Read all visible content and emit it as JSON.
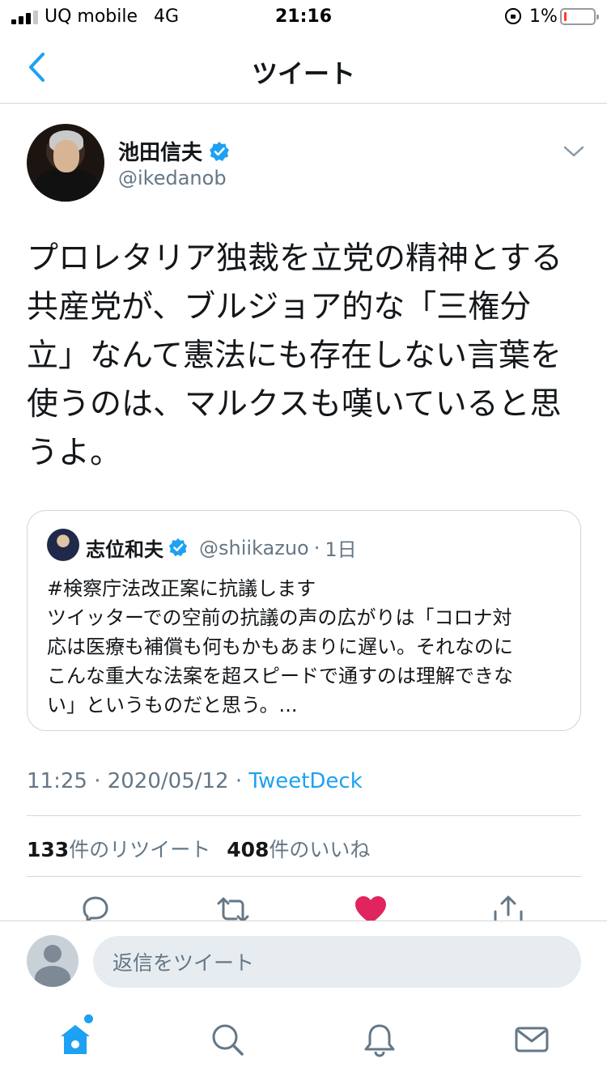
{
  "status_bar": {
    "carrier": "UQ mobile",
    "network": "4G",
    "time": "21:16",
    "battery": "1%"
  },
  "nav": {
    "title": "ツイート",
    "back_icon": "chevron-left-icon"
  },
  "tweet": {
    "author_name": "池田信夫",
    "author_handle": "@ikedanob",
    "verified": true,
    "text": "プロレタリア独裁を立党の精神とする\n共産党が、ブルジョア的な「三権分\n立」なんて憲法にも存在しない言葉を\n使うのは、マルクスも嘆いていると思\nうよ。",
    "quote": {
      "author_name": "志位和夫",
      "author_handle": "@shiikazuo",
      "age": "1日",
      "text": "#検察庁法改正案に抗議します\nツイッターでの空前の抗議の声の広がりは「コロナ対\n応は医療も補償も何もかもあまりに遅い。それなのに\nこんな重大な法案を超スピードで通すのは理解できな\nい」というものだと思う。..."
    },
    "timestamp": "11:25 · 2020/05/12 · ",
    "source": "TweetDeck",
    "retweet_count": "133",
    "retweet_label": "件のリツイート",
    "like_count": "408",
    "like_label": "件のいいね"
  },
  "reply": {
    "placeholder": "返信をツイート"
  },
  "colors": {
    "accent": "#1da1f2",
    "like": "#e0245e",
    "secondary_text": "#657786"
  },
  "tabs": [
    "home-icon",
    "search-icon",
    "bell-icon",
    "mail-icon"
  ]
}
